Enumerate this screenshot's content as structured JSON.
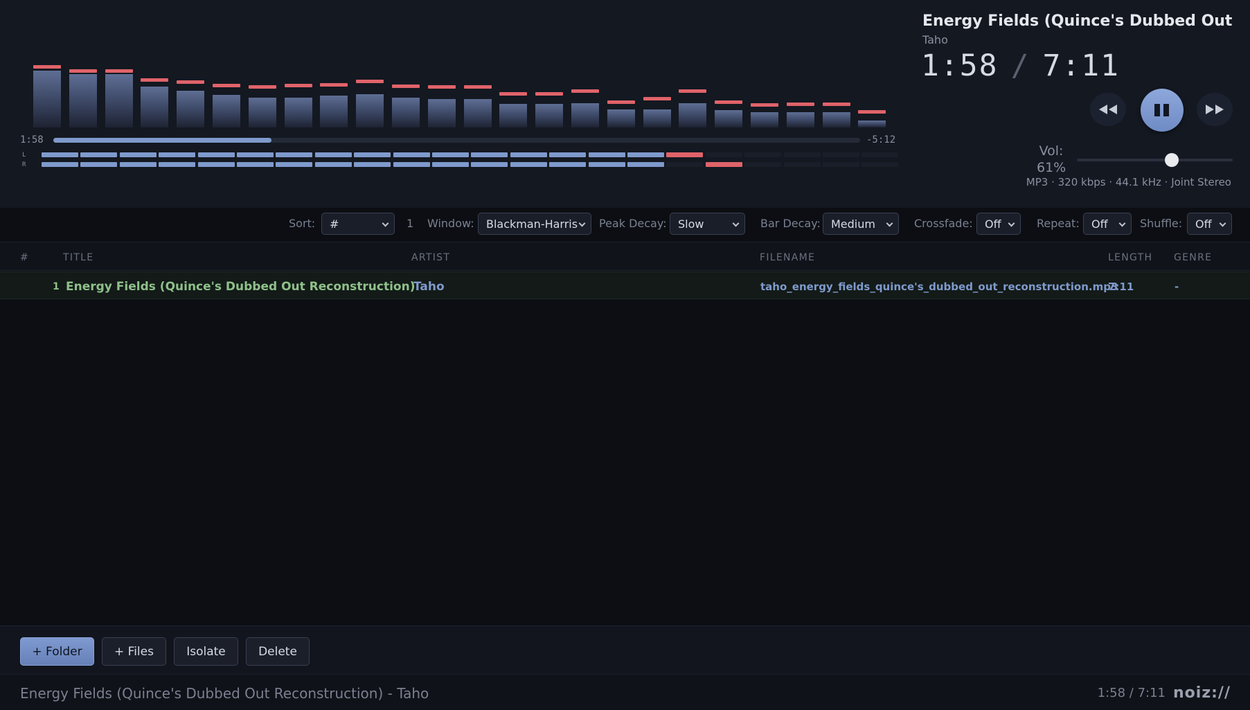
{
  "player": {
    "now_playing_title": "Energy Fields (Quince's Dubbed Out Re...",
    "now_playing_artist": "Taho",
    "elapsed": "1:58",
    "duration": "7:11",
    "separator": "/",
    "elapsed_small": "1:58",
    "remaining_small": "-5:12",
    "progress_fraction": 0.27,
    "volume_label": "Vol: 61%",
    "volume_fraction": 0.61,
    "track_info": "MP3 · 320 kbps · 44.1 kHz · Joint Stereo",
    "channel_l": "L",
    "channel_r": "R",
    "meter_l_segments": 17,
    "meter_r_segments": 18
  },
  "spectrum": {
    "bar_levels": [
      0.77,
      0.73,
      0.73,
      0.56,
      0.5,
      0.44,
      0.41,
      0.41,
      0.43,
      0.45,
      0.41,
      0.39,
      0.39,
      0.32,
      0.32,
      0.33,
      0.25,
      0.25,
      0.33,
      0.24,
      0.21,
      0.21,
      0.21,
      0.09
    ],
    "peak_levels": [
      0.8,
      0.75,
      0.75,
      0.62,
      0.59,
      0.55,
      0.53,
      0.55,
      0.56,
      0.6,
      0.54,
      0.53,
      0.53,
      0.43,
      0.43,
      0.47,
      0.32,
      0.37,
      0.47,
      0.32,
      0.28,
      0.29,
      0.29,
      0.19
    ],
    "colors": {
      "bar": "#5e6e94",
      "peak": "#e0636a"
    }
  },
  "options": {
    "sort_label": "Sort:",
    "sort_value": "#",
    "sort_count": "1",
    "window_label": "Window:",
    "window_value": "Blackman-Harris",
    "peak_decay_label": "Peak Decay:",
    "peak_decay_value": "Slow",
    "bar_decay_label": "Bar Decay:",
    "bar_decay_value": "Medium",
    "crossfade_label": "Crossfade:",
    "crossfade_value": "Off",
    "repeat_label": "Repeat:",
    "repeat_value": "Off",
    "shuffle_label": "Shuffle:",
    "shuffle_value": "Off"
  },
  "playlist": {
    "columns": [
      "#",
      "TITLE",
      "ARTIST",
      "FILENAME",
      "LENGTH",
      "GENRE"
    ],
    "rows": [
      {
        "num": "1",
        "title": "Energy Fields (Quince's Dubbed Out Reconstruction)",
        "artist": "Taho",
        "filename": "taho_energy_fields_quince's_dubbed_out_reconstruction.mp3",
        "length": "7:11",
        "genre": "-"
      }
    ]
  },
  "actions": {
    "folder": "+ Folder",
    "files": "+ Files",
    "isolate": "Isolate",
    "delete": "Delete"
  },
  "status": {
    "text": "Energy Fields (Quince's Dubbed Out Reconstruction) - Taho",
    "time": "1:58 / 7:11",
    "logo": "noiz://"
  },
  "icons": {
    "prev": "rewind-icon",
    "play_pause": "pause-icon",
    "next": "fast-forward-icon"
  },
  "colors": {
    "accent": "#7f9acc",
    "peak": "#e0636a",
    "playing_title": "#8fc08a",
    "artist_link": "#7f9acc"
  }
}
